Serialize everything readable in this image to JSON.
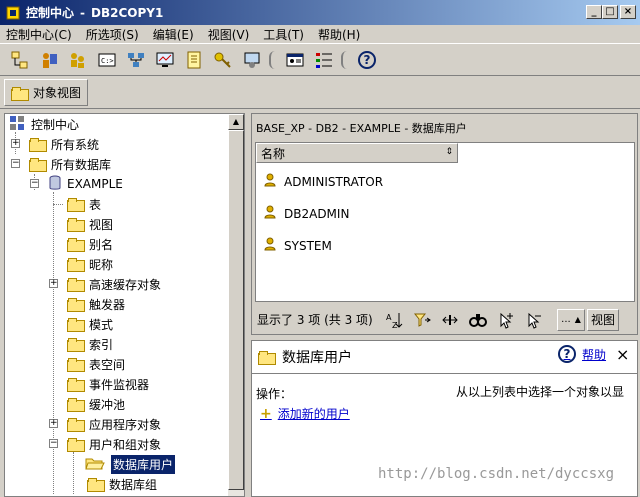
{
  "window": {
    "title": "控制中心",
    "sep": "-",
    "instance": "DB2COPY1",
    "min": "_",
    "max": "□",
    "close": "×"
  },
  "menu": [
    "控制中心(C)",
    "所选项(S)",
    "编辑(E)",
    "视图(V)",
    "工具(T)",
    "帮助(H)"
  ],
  "toolbar": {
    "icons": [
      "tree-icon",
      "object-icon",
      "users-icon",
      "command-icon",
      "task-icon",
      "monitor-icon",
      "journal-icon",
      "license-icon",
      "config-icon",
      "dialog-icon",
      "list-icon",
      "help-icon"
    ],
    "help_glyph": "?"
  },
  "tab": {
    "label": "对象视图"
  },
  "tree": {
    "root": "控制中心",
    "items": [
      {
        "label": "所有系统"
      },
      {
        "label": "所有数据库"
      },
      {
        "label": "EXAMPLE"
      },
      {
        "label": "表"
      },
      {
        "label": "视图"
      },
      {
        "label": "别名"
      },
      {
        "label": "昵称"
      },
      {
        "label": "高速缓存对象"
      },
      {
        "label": "触发器"
      },
      {
        "label": "模式"
      },
      {
        "label": "索引"
      },
      {
        "label": "表空间"
      },
      {
        "label": "事件监视器"
      },
      {
        "label": "缓冲池"
      },
      {
        "label": "应用程序对象"
      },
      {
        "label": "用户和组对象"
      },
      {
        "label": "数据库用户"
      },
      {
        "label": "数据库组"
      }
    ],
    "expand_plus": "+",
    "expand_minus": "−"
  },
  "content": {
    "path": "BASE_XP - DB2 - EXAMPLE - 数据库用户",
    "column": "名称",
    "sort_glyph": "⇕",
    "users": [
      "ADMINISTRATOR",
      "DB2ADMIN",
      "SYSTEM"
    ],
    "status": "显示了 3 项 (共 3 项)",
    "more": "...",
    "view": "视图"
  },
  "detail": {
    "title": "数据库用户",
    "help": "帮助",
    "help_glyph": "?",
    "close": "×",
    "actions_label": "操作：",
    "desc": "从以上列表中选择一个对象以显",
    "add": "添加新的用户",
    "add_glyph": "+"
  },
  "watermark": "http://blog.csdn.net/dyccsxg"
}
